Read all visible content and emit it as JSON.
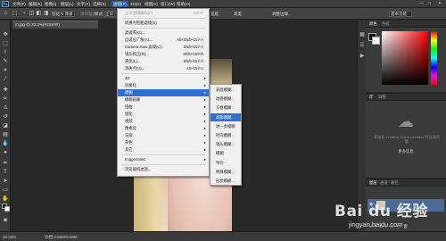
{
  "menubar": {
    "items": [
      "文件(F)",
      "编辑(E)",
      "图像(I)",
      "图层(L)",
      "文字(Y)",
      "选择(S)",
      "滤镜(T)",
      "3D(D)",
      "视图(V)",
      "窗口(W)",
      "帮助(H)"
    ],
    "active_index": 6,
    "logo": "Ps",
    "window_controls": [
      "—",
      "□",
      "✕"
    ]
  },
  "optbar": {
    "feather_label": "羽化:",
    "feather_value": "0 像素",
    "antialias": "消除锯齿",
    "style_label": "样式:",
    "style_value": "正常",
    "width_label": "宽度:",
    "height_label": "高度:",
    "refine_edge": "调整边缘...",
    "workspace": "基本功能"
  },
  "document": {
    "tab_title": "m.jpg @ 33.3%(RGB/8#)"
  },
  "filter_menu": {
    "items": [
      {
        "label": "上次滤镜操作(F)",
        "shortcut": "Ctrl+F",
        "disabled": true
      },
      {
        "sep": true
      },
      {
        "label": "转换为智能滤镜(S)"
      },
      {
        "sep": true
      },
      {
        "label": "滤镜库(G)..."
      },
      {
        "label": "自适应广角(A)...",
        "shortcut": "Alt+Shift+Ctrl+A"
      },
      {
        "label": "Camera Raw 滤镜(C)...",
        "shortcut": "Shift+Ctrl+A"
      },
      {
        "label": "镜头校正(R)...",
        "shortcut": "Shift+Ctrl+R"
      },
      {
        "label": "液化(L)...",
        "shortcut": "Shift+Ctrl+X"
      },
      {
        "label": "消失点(V)...",
        "shortcut": "Alt+Ctrl+V"
      },
      {
        "sep": true
      },
      {
        "label": "3D",
        "submenu": true
      },
      {
        "label": "风格化",
        "submenu": true
      },
      {
        "label": "模糊",
        "submenu": true,
        "highlighted": true
      },
      {
        "label": "模糊画廊",
        "submenu": true
      },
      {
        "label": "扭曲",
        "submenu": true
      },
      {
        "label": "锐化",
        "submenu": true
      },
      {
        "label": "视频",
        "submenu": true
      },
      {
        "label": "像素化",
        "submenu": true
      },
      {
        "label": "渲染",
        "submenu": true
      },
      {
        "label": "杂色",
        "submenu": true
      },
      {
        "label": "其它",
        "submenu": true
      },
      {
        "sep": true
      },
      {
        "label": "Imagenomic",
        "submenu": true
      },
      {
        "sep": true
      },
      {
        "label": "浏览联机滤镜..."
      }
    ]
  },
  "blur_submenu": {
    "items": [
      "表面模糊...",
      "动感模糊...",
      "方框模糊...",
      "高斯模糊...",
      "进一步模糊",
      "径向模糊...",
      "镜头模糊...",
      "模糊",
      "平均",
      "特殊模糊...",
      "形状模糊..."
    ],
    "highlight_index": 3
  },
  "color_panel": {
    "tabs": [
      "颜色",
      "色板"
    ]
  },
  "library_panel": {
    "tabs": [
      "库",
      "调整"
    ],
    "message": "初始化 Creative Cloud Libraries 时出现问题",
    "link": "更多信息"
  },
  "layers_panel": {
    "tabs": [
      "图层",
      "通道",
      "路径"
    ]
  },
  "status": {
    "zoom": "33.33%",
    "doc_info": "文档:3.66M/3.66M"
  },
  "watermark": {
    "main": "Bai du 经验",
    "sub": "jingyan.baidu.com"
  },
  "colors": {
    "menu_highlight": "#2f6fd0",
    "panel_bg": "#3a3a3a",
    "canvas_bg": "#282828"
  }
}
